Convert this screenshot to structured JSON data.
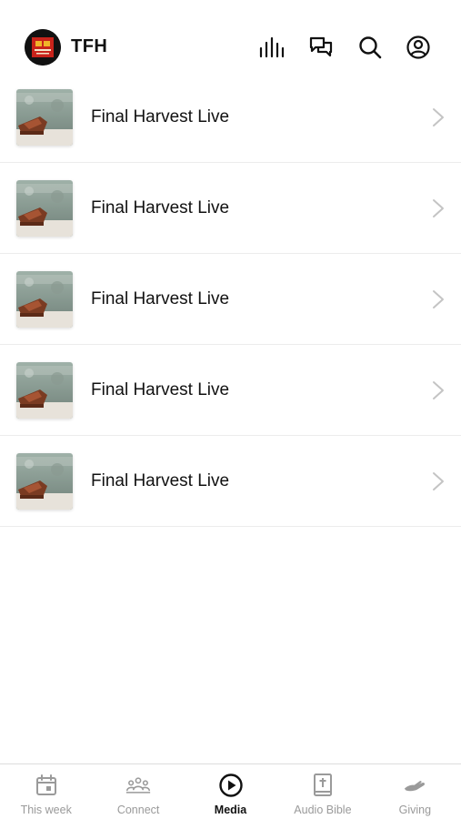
{
  "header": {
    "title": "TFH",
    "icons": [
      "live-bars-icon",
      "chat-icon",
      "search-icon",
      "profile-icon"
    ]
  },
  "list": {
    "items": [
      {
        "title": "Final Harvest Live"
      },
      {
        "title": "Final Harvest Live"
      },
      {
        "title": "Final Harvest Live"
      },
      {
        "title": "Final Harvest Live"
      },
      {
        "title": "Final Harvest Live"
      }
    ]
  },
  "tabbar": {
    "tabs": [
      {
        "label": "This week",
        "icon": "calendar-icon",
        "active": false
      },
      {
        "label": "Connect",
        "icon": "group-icon",
        "active": false
      },
      {
        "label": "Media",
        "icon": "play-circle-icon",
        "active": true
      },
      {
        "label": "Audio Bible",
        "icon": "bible-icon",
        "active": false
      },
      {
        "label": "Giving",
        "icon": "giving-hand-icon",
        "active": false
      }
    ]
  },
  "colors": {
    "text": "#111111",
    "inactive": "#9a9a9a",
    "divider": "#ececec"
  }
}
